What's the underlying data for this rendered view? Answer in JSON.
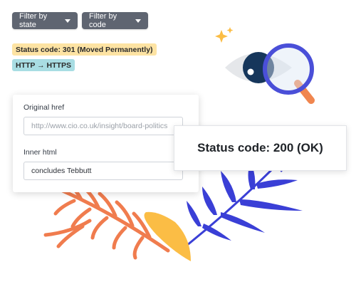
{
  "filters": {
    "state_label": "Filter by state",
    "code_label": "Filter by code"
  },
  "badges": {
    "status_301": "Status code: 301 (Moved Permanently)",
    "status_301_color": "#fde3a3",
    "redirect": "HTTP → HTTPS",
    "redirect_color": "#a8dde3"
  },
  "form": {
    "original_href_label": "Original href",
    "original_href_placeholder": "http://www.cio.co.uk/insight/board-politics",
    "inner_html_label": "Inner html",
    "inner_html_value": "concludes Tebbutt"
  },
  "result": {
    "status_200": "Status code: 200 (OK)"
  },
  "decor": {
    "eye_icon": "eye-icon",
    "magnifier_icon": "magnifying-glass-icon",
    "sparkle_icon": "sparkle-icon",
    "accent_orange": "#f07c4e",
    "accent_yellow": "#fbbd45",
    "accent_blue": "#3a3fd6"
  }
}
